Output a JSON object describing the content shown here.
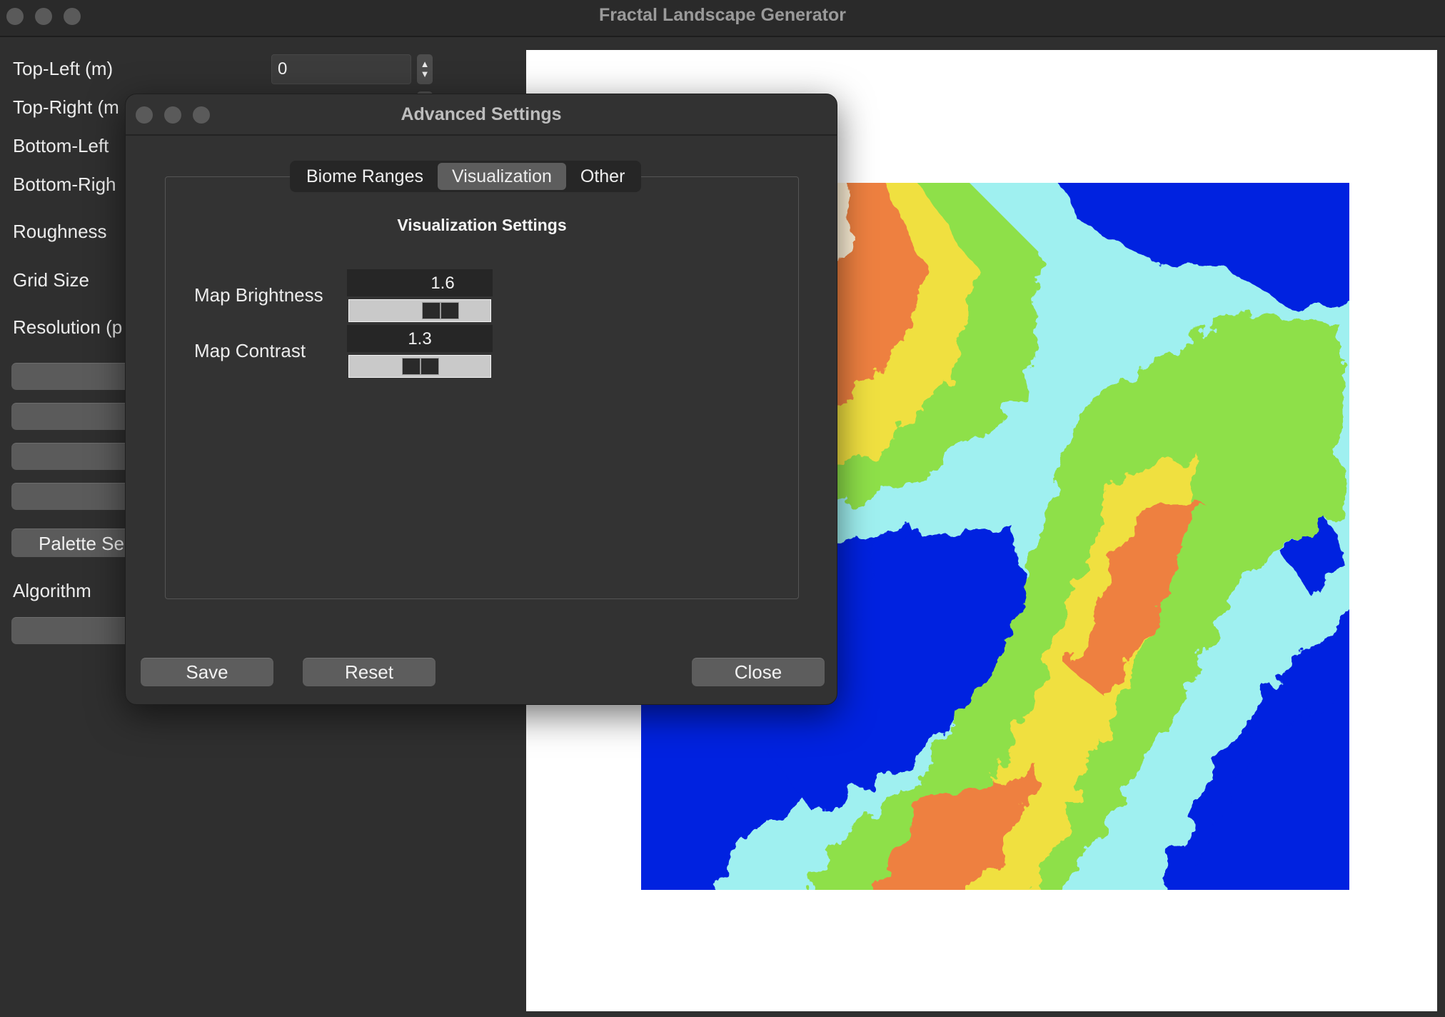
{
  "window": {
    "title": "Fractal Landscape Generator"
  },
  "left_panel": {
    "fields": [
      {
        "label": "Top-Left (m)",
        "value": "0"
      },
      {
        "label": "Top-Right (m"
      },
      {
        "label": "Bottom-Left"
      },
      {
        "label": "Bottom-Righ"
      },
      {
        "label": "Roughness"
      },
      {
        "label": "Grid Size"
      },
      {
        "label": "Resolution (p"
      }
    ],
    "palette_button": "Palette Se",
    "algorithm_label": "Algorithm"
  },
  "dialog": {
    "title": "Advanced Settings",
    "tabs": [
      "Biome Ranges",
      "Visualization",
      "Other"
    ],
    "active_tab": "Visualization",
    "section_title": "Visualization Settings",
    "brightness": {
      "label": "Map Brightness",
      "value": "1.6"
    },
    "contrast": {
      "label": "Map Contrast",
      "value": "1.3"
    },
    "buttons": {
      "save": "Save",
      "reset": "Reset",
      "close": "Close"
    }
  },
  "colors": {
    "water": "#0022e0",
    "shallow": "#9ff0f0",
    "lowland": "#8ee04a",
    "hills": "#f0e040",
    "mountain": "#ee8040",
    "peak": "#fff2d8"
  }
}
